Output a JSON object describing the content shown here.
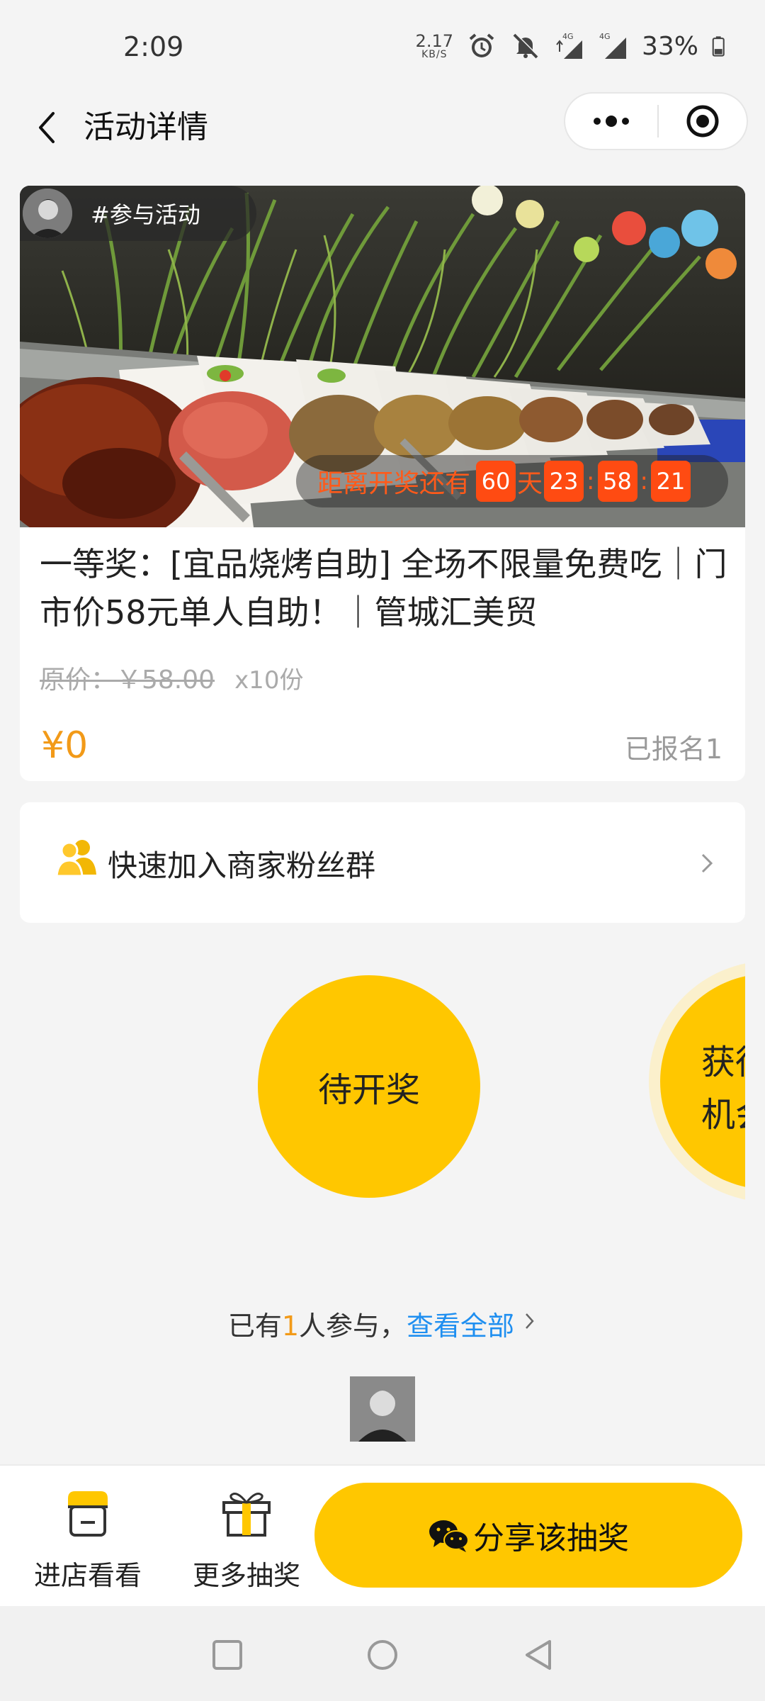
{
  "status_bar": {
    "time": "2:09",
    "net_speed_value": "2.17",
    "net_speed_unit": "KB/S",
    "network": "4G",
    "battery": "33%",
    "icons": [
      "alarm-icon",
      "mute-icon",
      "signal-icon",
      "signal-icon",
      "battery-icon"
    ]
  },
  "nav": {
    "title": "活动详情",
    "icons": [
      "back-arrow-icon",
      "more-dots-icon",
      "close-target-icon"
    ]
  },
  "hero": {
    "tag": "#参与活动",
    "countdown": {
      "label": "距离开奖还有",
      "days": "60",
      "day_unit": "天",
      "hours": "23",
      "minutes": "58",
      "seconds": "21",
      "separator": ":"
    }
  },
  "prize": {
    "title": "一等奖：[宜品烧烤自助] 全场不限量免费吃｜门市价58元单人自助！｜管城汇美贸",
    "original_price": "原价：￥58.00",
    "quantity": "x10份",
    "price": "¥0",
    "signup_count": "已报名1"
  },
  "fan_group": {
    "label": "快速加入商家粉丝群",
    "icons": [
      "users-icon",
      "chevron-right-icon"
    ]
  },
  "status": {
    "waiting_label": "待开奖",
    "chance_label": "获得机会"
  },
  "participants": {
    "prefix": "已有",
    "count": "1",
    "suffix": "人参与，",
    "view_all": "查看全部"
  },
  "bottom_bar": {
    "store_label": "进店看看",
    "more_label": "更多抽奖",
    "share_label": "分享该抽奖",
    "icons": [
      "store-icon",
      "gift-icon",
      "wechat-icon"
    ]
  },
  "colors": {
    "accent_yellow": "#ffc700",
    "price_orange": "#f29a18",
    "countdown_red": "#ff4b12",
    "link_blue": "#1f8ff0"
  }
}
